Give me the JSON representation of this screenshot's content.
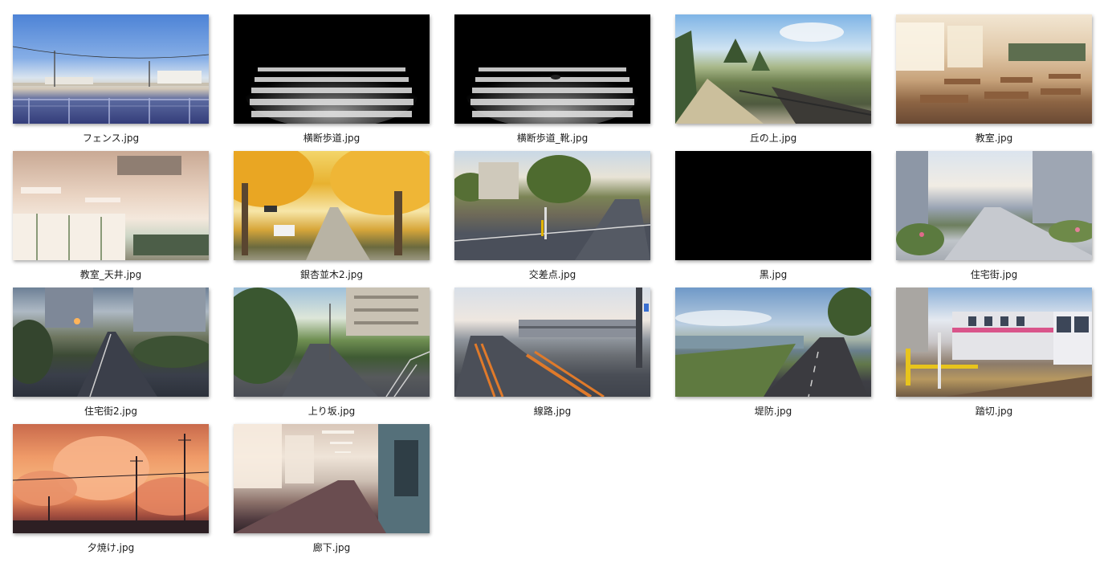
{
  "files": [
    {
      "name": "フェンス.jpg",
      "thumb": "fence"
    },
    {
      "name": "横断歩道.jpg",
      "thumb": "crosswalk"
    },
    {
      "name": "横断歩道_靴.jpg",
      "thumb": "crosswalk-shoe"
    },
    {
      "name": "丘の上.jpg",
      "thumb": "hill"
    },
    {
      "name": "教室.jpg",
      "thumb": "classroom"
    },
    {
      "name": "教室_天井.jpg",
      "thumb": "ceiling"
    },
    {
      "name": "銀杏並木2.jpg",
      "thumb": "ginkgo"
    },
    {
      "name": "交差点.jpg",
      "thumb": "intersection"
    },
    {
      "name": "黒.jpg",
      "thumb": "black"
    },
    {
      "name": "住宅街.jpg",
      "thumb": "residential"
    },
    {
      "name": "住宅街2.jpg",
      "thumb": "residential2"
    },
    {
      "name": "上り坂.jpg",
      "thumb": "slope"
    },
    {
      "name": "線路.jpg",
      "thumb": "track"
    },
    {
      "name": "堤防.jpg",
      "thumb": "levee"
    },
    {
      "name": "踏切.jpg",
      "thumb": "railroad-crossing"
    },
    {
      "name": "夕焼け.jpg",
      "thumb": "sunset"
    },
    {
      "name": "廊下.jpg",
      "thumb": "hallway"
    }
  ]
}
